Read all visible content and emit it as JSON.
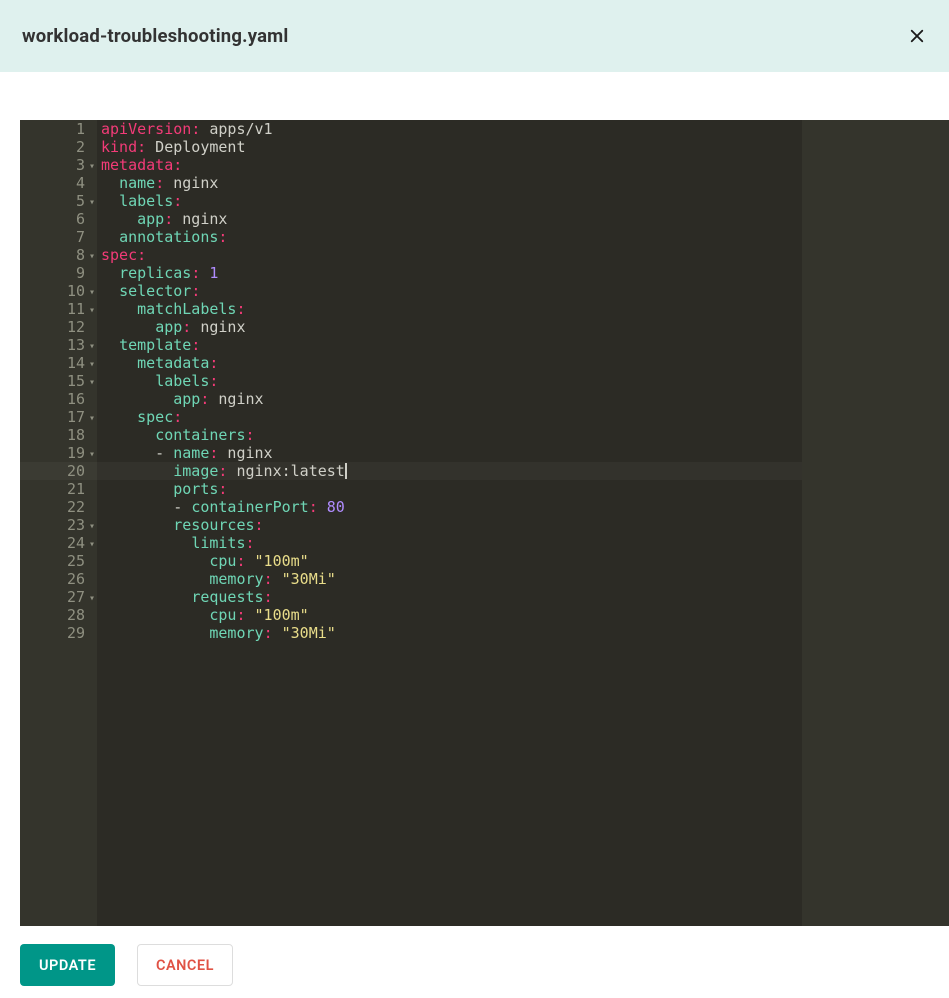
{
  "header": {
    "title": "workload-troubleshooting.yaml"
  },
  "editor": {
    "active_line": 20,
    "lines": [
      {
        "n": 1,
        "fold": false,
        "tokens": [
          [
            "key",
            "apiVersion"
          ],
          [
            "colon",
            ":"
          ],
          [
            "value",
            " apps/v1"
          ]
        ]
      },
      {
        "n": 2,
        "fold": false,
        "tokens": [
          [
            "key",
            "kind"
          ],
          [
            "colon",
            ":"
          ],
          [
            "value",
            " Deployment"
          ]
        ]
      },
      {
        "n": 3,
        "fold": true,
        "tokens": [
          [
            "key",
            "metadata"
          ],
          [
            "colon",
            ":"
          ]
        ]
      },
      {
        "n": 4,
        "fold": false,
        "tokens": [
          [
            "plain",
            "  "
          ],
          [
            "teal",
            "name"
          ],
          [
            "colon",
            ":"
          ],
          [
            "value",
            " nginx"
          ]
        ]
      },
      {
        "n": 5,
        "fold": true,
        "tokens": [
          [
            "plain",
            "  "
          ],
          [
            "teal",
            "labels"
          ],
          [
            "colon",
            ":"
          ]
        ]
      },
      {
        "n": 6,
        "fold": false,
        "tokens": [
          [
            "plain",
            "    "
          ],
          [
            "teal",
            "app"
          ],
          [
            "colon",
            ":"
          ],
          [
            "value",
            " nginx"
          ]
        ]
      },
      {
        "n": 7,
        "fold": false,
        "tokens": [
          [
            "plain",
            "  "
          ],
          [
            "teal",
            "annotations"
          ],
          [
            "colon",
            ":"
          ]
        ]
      },
      {
        "n": 8,
        "fold": true,
        "tokens": [
          [
            "key",
            "spec"
          ],
          [
            "colon",
            ":"
          ]
        ]
      },
      {
        "n": 9,
        "fold": false,
        "tokens": [
          [
            "plain",
            "  "
          ],
          [
            "teal",
            "replicas"
          ],
          [
            "colon",
            ":"
          ],
          [
            "plain",
            " "
          ],
          [
            "num",
            "1"
          ]
        ]
      },
      {
        "n": 10,
        "fold": true,
        "tokens": [
          [
            "plain",
            "  "
          ],
          [
            "teal",
            "selector"
          ],
          [
            "colon",
            ":"
          ]
        ]
      },
      {
        "n": 11,
        "fold": true,
        "tokens": [
          [
            "plain",
            "    "
          ],
          [
            "teal",
            "matchLabels"
          ],
          [
            "colon",
            ":"
          ]
        ]
      },
      {
        "n": 12,
        "fold": false,
        "tokens": [
          [
            "plain",
            "      "
          ],
          [
            "teal",
            "app"
          ],
          [
            "colon",
            ":"
          ],
          [
            "value",
            " nginx"
          ]
        ]
      },
      {
        "n": 13,
        "fold": true,
        "tokens": [
          [
            "plain",
            "  "
          ],
          [
            "teal",
            "template"
          ],
          [
            "colon",
            ":"
          ]
        ]
      },
      {
        "n": 14,
        "fold": true,
        "tokens": [
          [
            "plain",
            "    "
          ],
          [
            "teal",
            "metadata"
          ],
          [
            "colon",
            ":"
          ]
        ]
      },
      {
        "n": 15,
        "fold": true,
        "tokens": [
          [
            "plain",
            "      "
          ],
          [
            "teal",
            "labels"
          ],
          [
            "colon",
            ":"
          ]
        ]
      },
      {
        "n": 16,
        "fold": false,
        "tokens": [
          [
            "plain",
            "        "
          ],
          [
            "teal",
            "app"
          ],
          [
            "colon",
            ":"
          ],
          [
            "value",
            " nginx"
          ]
        ]
      },
      {
        "n": 17,
        "fold": true,
        "tokens": [
          [
            "plain",
            "    "
          ],
          [
            "teal",
            "spec"
          ],
          [
            "colon",
            ":"
          ]
        ]
      },
      {
        "n": 18,
        "fold": false,
        "tokens": [
          [
            "plain",
            "      "
          ],
          [
            "teal",
            "containers"
          ],
          [
            "colon",
            ":"
          ]
        ]
      },
      {
        "n": 19,
        "fold": true,
        "tokens": [
          [
            "plain",
            "      - "
          ],
          [
            "teal",
            "name"
          ],
          [
            "colon",
            ":"
          ],
          [
            "value",
            " nginx"
          ]
        ]
      },
      {
        "n": 20,
        "fold": false,
        "tokens": [
          [
            "plain",
            "        "
          ],
          [
            "teal",
            "image"
          ],
          [
            "colon",
            ":"
          ],
          [
            "value",
            " nginx:latest"
          ]
        ]
      },
      {
        "n": 21,
        "fold": false,
        "tokens": [
          [
            "plain",
            "        "
          ],
          [
            "teal",
            "ports"
          ],
          [
            "colon",
            ":"
          ]
        ]
      },
      {
        "n": 22,
        "fold": false,
        "tokens": [
          [
            "plain",
            "        - "
          ],
          [
            "teal",
            "containerPort"
          ],
          [
            "colon",
            ":"
          ],
          [
            "plain",
            " "
          ],
          [
            "num",
            "80"
          ]
        ]
      },
      {
        "n": 23,
        "fold": true,
        "tokens": [
          [
            "plain",
            "        "
          ],
          [
            "teal",
            "resources"
          ],
          [
            "colon",
            ":"
          ]
        ]
      },
      {
        "n": 24,
        "fold": true,
        "tokens": [
          [
            "plain",
            "          "
          ],
          [
            "teal",
            "limits"
          ],
          [
            "colon",
            ":"
          ]
        ]
      },
      {
        "n": 25,
        "fold": false,
        "tokens": [
          [
            "plain",
            "            "
          ],
          [
            "teal",
            "cpu"
          ],
          [
            "colon",
            ":"
          ],
          [
            "plain",
            " "
          ],
          [
            "str",
            "\"100m\""
          ]
        ]
      },
      {
        "n": 26,
        "fold": false,
        "tokens": [
          [
            "plain",
            "            "
          ],
          [
            "teal",
            "memory"
          ],
          [
            "colon",
            ":"
          ],
          [
            "plain",
            " "
          ],
          [
            "str",
            "\"30Mi\""
          ]
        ]
      },
      {
        "n": 27,
        "fold": true,
        "tokens": [
          [
            "plain",
            "          "
          ],
          [
            "teal",
            "requests"
          ],
          [
            "colon",
            ":"
          ]
        ]
      },
      {
        "n": 28,
        "fold": false,
        "tokens": [
          [
            "plain",
            "            "
          ],
          [
            "teal",
            "cpu"
          ],
          [
            "colon",
            ":"
          ],
          [
            "plain",
            " "
          ],
          [
            "str",
            "\"100m\""
          ]
        ]
      },
      {
        "n": 29,
        "fold": false,
        "tokens": [
          [
            "plain",
            "            "
          ],
          [
            "teal",
            "memory"
          ],
          [
            "colon",
            ":"
          ],
          [
            "plain",
            " "
          ],
          [
            "str",
            "\"30Mi\""
          ]
        ]
      }
    ]
  },
  "buttons": {
    "update": "UPDATE",
    "cancel": "CANCEL"
  }
}
